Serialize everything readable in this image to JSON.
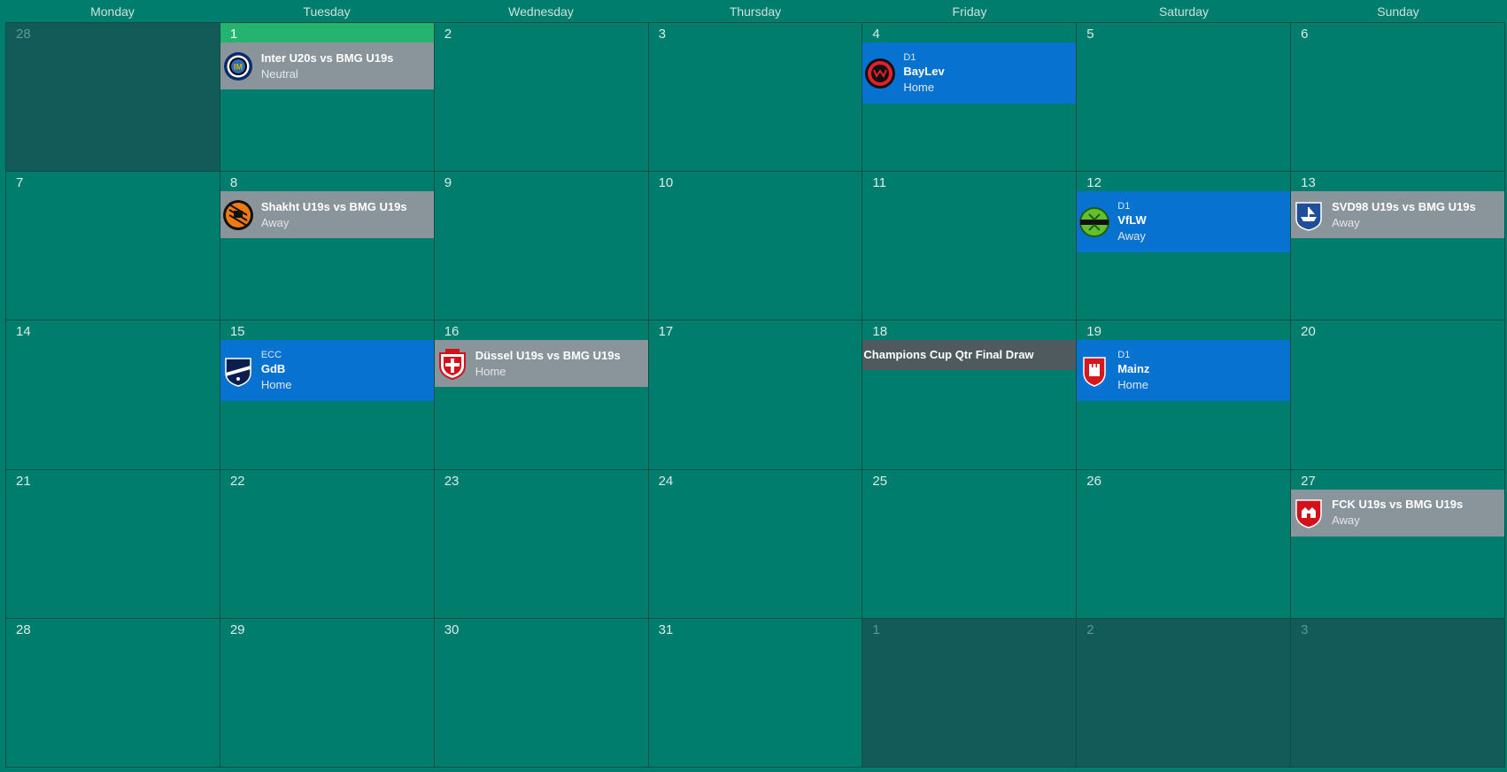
{
  "weekdays": [
    "Monday",
    "Tuesday",
    "Wednesday",
    "Thursday",
    "Friday",
    "Saturday",
    "Sunday"
  ],
  "days": [
    "28",
    "1",
    "2",
    "3",
    "4",
    "5",
    "6",
    "7",
    "8",
    "9",
    "10",
    "11",
    "12",
    "13",
    "14",
    "15",
    "16",
    "17",
    "18",
    "19",
    "20",
    "21",
    "22",
    "23",
    "24",
    "25",
    "26",
    "27",
    "28",
    "29",
    "30",
    "31",
    "1",
    "2",
    "3"
  ],
  "events": {
    "d1": {
      "title": "Inter U20s vs BMG U19s",
      "sub": "Neutral",
      "icon": "inter-crest-icon"
    },
    "d4": {
      "comp": "D1",
      "title": "BayLev",
      "sub": "Home",
      "icon": "leverkusen-crest-icon"
    },
    "d8": {
      "title": "Shakht U19s vs BMG U19s",
      "sub": "Away",
      "icon": "shakhtar-crest-icon"
    },
    "d12": {
      "comp": "D1",
      "title": "VfLW",
      "sub": "Away",
      "icon": "wolfsburg-crest-icon"
    },
    "d13": {
      "title": "SVD98 U19s vs BMG U19s",
      "sub": "Away",
      "icon": "darmstadt-crest-icon"
    },
    "d15": {
      "comp": "ECC",
      "title": "GdB",
      "sub": "Home",
      "icon": "bordeaux-crest-icon"
    },
    "d16": {
      "title": "Düssel U19s vs BMG U19s",
      "sub": "Home",
      "icon": "dusseldorf-crest-icon"
    },
    "d18": {
      "title": "Champions Cup Qtr Final Draw"
    },
    "d19": {
      "comp": "D1",
      "title": "Mainz",
      "sub": "Home",
      "icon": "mainz-crest-icon"
    },
    "d27": {
      "title": "FCK U19s vs BMG U19s",
      "sub": "Away",
      "icon": "kaiserslautern-crest-icon"
    }
  },
  "colors": {
    "background": "#017d6e",
    "other_month": "#125b58",
    "today": "#25b46f",
    "friendly": "#8a959b",
    "competition": "#0872d1",
    "draw": "#4f5a5e"
  }
}
